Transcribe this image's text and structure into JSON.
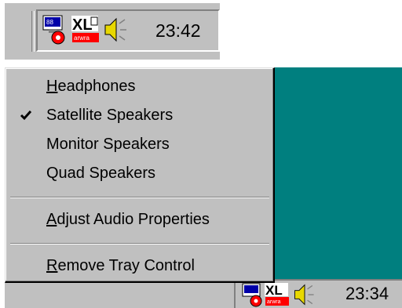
{
  "top_tray": {
    "clock": "23:42"
  },
  "bottom_tray": {
    "clock": "23:34"
  },
  "tray_icons": [
    "display-settings-icon",
    "xl-app-icon",
    "speaker-icon"
  ],
  "menu": {
    "items": [
      {
        "name": "headphones",
        "pre": "",
        "u": "H",
        "post": "eadphones",
        "checked": false
      },
      {
        "name": "satellite-speakers",
        "pre": "Satellite Speakers",
        "u": "",
        "post": "",
        "checked": true
      },
      {
        "name": "monitor-speakers",
        "pre": "Monitor Speakers",
        "u": "",
        "post": "",
        "checked": false
      },
      {
        "name": "quad-speakers",
        "pre": "Quad Speakers",
        "u": "",
        "post": "",
        "checked": false
      },
      {
        "name": "adjust-audio-properties",
        "pre": "",
        "u": "A",
        "post": "djust Audio Properties",
        "checked": false
      },
      {
        "name": "remove-tray-control",
        "pre": "",
        "u": "R",
        "post": "emove Tray Control",
        "checked": false
      }
    ]
  },
  "colors": {
    "face": "#c0c0c0",
    "desktop": "#007f7f",
    "badge_red": "#ff0000"
  }
}
